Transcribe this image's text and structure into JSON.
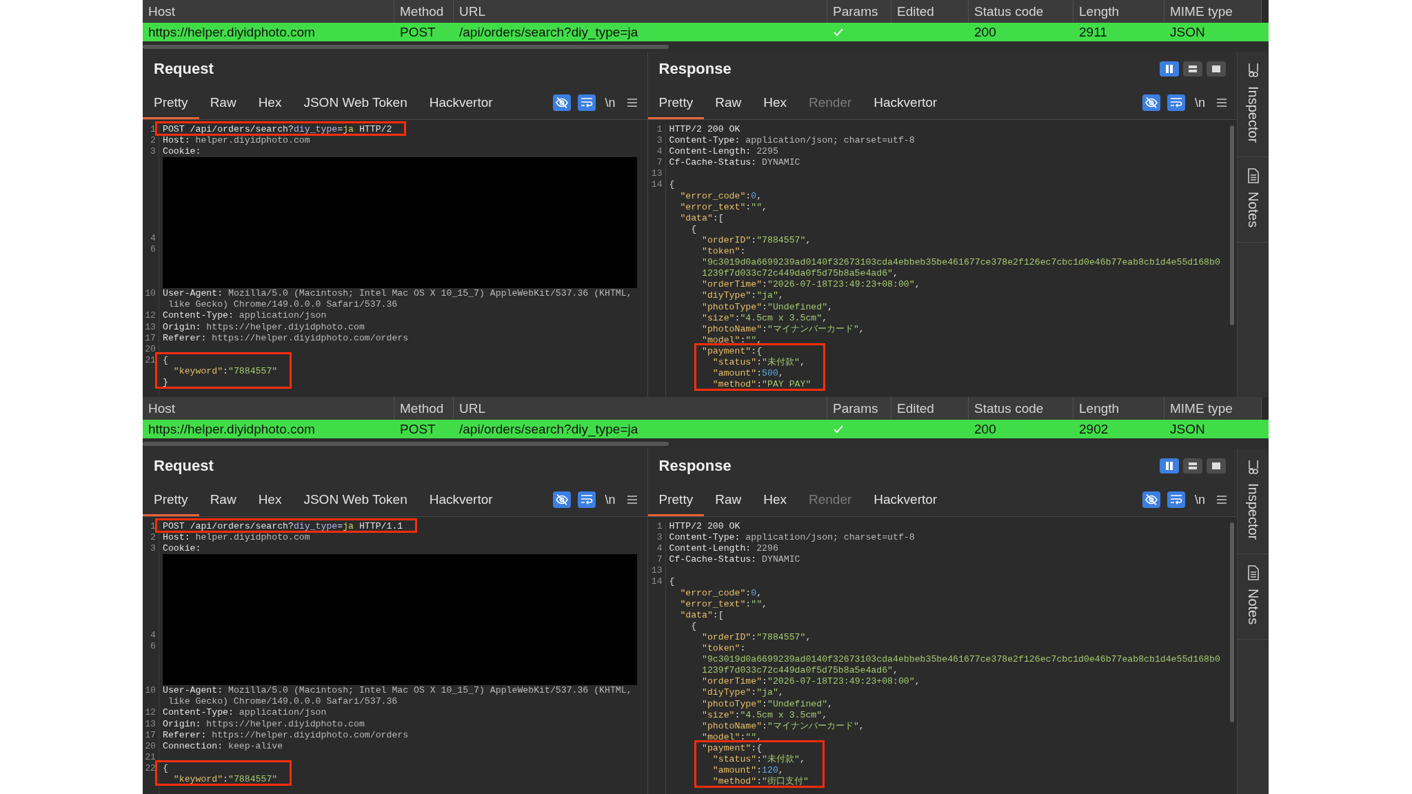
{
  "blocks": [
    {
      "table": {
        "columns": [
          "Host",
          "Method",
          "URL",
          "Params",
          "Edited",
          "Status code",
          "Length",
          "MIME type"
        ],
        "rows": [
          {
            "selected": true,
            "host": "https://helper.diyidphoto.com",
            "method": "POST",
            "url": "/api/orders/search?diy_type=ja",
            "params": true,
            "status_code": "200",
            "length": "2911",
            "mime_type": "JSON"
          }
        ]
      },
      "request": {
        "title": "Request",
        "tabs": [
          {
            "label": "Pretty",
            "selected": true,
            "disabled": false
          },
          {
            "label": "Raw",
            "selected": false,
            "disabled": false
          },
          {
            "label": "Hex",
            "selected": false,
            "disabled": false
          },
          {
            "label": "JSON Web Token",
            "selected": false,
            "disabled": false
          },
          {
            "label": "Hackvertor",
            "selected": false,
            "disabled": false
          }
        ],
        "toggles": [
          {
            "kind": "hide",
            "on": true
          },
          {
            "kind": "wrap",
            "on": true
          }
        ],
        "newline_label": "\\n",
        "lines": [
          {
            "n": "1",
            "kind": "start",
            "text": "POST /api/orders/search?diy_type=ja HTTP/2",
            "boxed": true
          },
          {
            "n": "2",
            "kind": "header",
            "text": "Host: helper.diyidphoto.com",
            "boxed": false
          },
          {
            "n": "3",
            "kind": "header",
            "text": "Cookie:",
            "boxed": false
          },
          {
            "kind": "redacted",
            "numbers": [
              "4",
              "6"
            ]
          },
          {
            "n": "10",
            "kind": "header",
            "text": "User-Agent: Mozilla/5.0 (Macintosh; Intel Mac OS X 10_15_7) AppleWebKit/537.36 (KHTML, like Gecko) Chrome/149.0.0.0 Safari/537.36",
            "boxed": false
          },
          {
            "n": "12",
            "kind": "header",
            "text": "Content-Type: application/json",
            "boxed": false
          },
          {
            "n": "13",
            "kind": "header",
            "text": "Origin: https://helper.diyidphoto.com",
            "boxed": false
          },
          {
            "n": "17",
            "kind": "header",
            "text": "Referer: https://helper.diyidphoto.com/orders",
            "boxed": false
          },
          {
            "n": "20",
            "kind": "blank",
            "boxed": false
          },
          {
            "n": "21",
            "kind": "json",
            "text": "{",
            "boxed": true
          },
          {
            "kind": "json",
            "text": "  \"keyword\":\"7884557\"",
            "boxed": true
          },
          {
            "kind": "json",
            "text": "}",
            "boxed": true
          }
        ]
      },
      "response": {
        "title": "Response",
        "layout_buttons": [
          {
            "kind": "split",
            "selected": true
          },
          {
            "kind": "rows",
            "selected": false
          },
          {
            "kind": "single",
            "selected": false
          }
        ],
        "tabs": [
          {
            "label": "Pretty",
            "selected": true,
            "disabled": false
          },
          {
            "label": "Raw",
            "selected": false,
            "disabled": false
          },
          {
            "label": "Hex",
            "selected": false,
            "disabled": false
          },
          {
            "label": "Render",
            "selected": false,
            "disabled": true
          },
          {
            "label": "Hackvertor",
            "selected": false,
            "disabled": false
          }
        ],
        "toggles": [
          {
            "kind": "hide",
            "on": true
          },
          {
            "kind": "wrap",
            "on": true
          }
        ],
        "newline_label": "\\n",
        "lines": [
          {
            "n": "1",
            "kind": "header",
            "text": "HTTP/2 200 OK",
            "boxed": false
          },
          {
            "n": "3",
            "kind": "header",
            "text": "Content-Type: application/json; charset=utf-8",
            "boxed": false
          },
          {
            "n": "4",
            "kind": "header",
            "text": "Content-Length: 2295",
            "boxed": false
          },
          {
            "n": "7",
            "kind": "header",
            "text": "Cf-Cache-Status: DYNAMIC",
            "boxed": false
          },
          {
            "n": "13",
            "kind": "blank",
            "boxed": false
          },
          {
            "n": "14",
            "kind": "json",
            "text": "{",
            "boxed": false
          },
          {
            "kind": "json",
            "text": "  \"error_code\":0,",
            "boxed": false
          },
          {
            "kind": "json",
            "text": "  \"error_text\":\"\",",
            "boxed": false
          },
          {
            "kind": "json",
            "text": "  \"data\":[",
            "boxed": false
          },
          {
            "kind": "json",
            "text": "    {",
            "boxed": false
          },
          {
            "kind": "json",
            "text": "      \"orderID\":\"7884557\",",
            "boxed": false
          },
          {
            "kind": "json",
            "text": "      \"token\":",
            "boxed": false
          },
          {
            "kind": "json",
            "text": "      \"9c3019d0a6699239ad0140f32673103cda4ebbeb35be461677ce378e2f126ec7cbc1d0e46b77eab8cb1d4e55d168b01239f7d033c72c449da0f5d75b8a5e4ad6\",",
            "boxed": false
          },
          {
            "kind": "json",
            "text": "      \"orderTime\":\"2026-07-18T23:49:23+08:00\",",
            "boxed": false
          },
          {
            "kind": "json",
            "text": "      \"diyType\":\"ja\",",
            "boxed": false
          },
          {
            "kind": "json",
            "text": "      \"photoType\":\"Undefined\",",
            "boxed": false
          },
          {
            "kind": "json",
            "text": "      \"size\":\"4.5cm x 3.5cm\",",
            "boxed": false
          },
          {
            "kind": "json",
            "text": "      \"photoName\":\"マイナンバーカード\",",
            "boxed": false
          },
          {
            "kind": "json",
            "text": "      \"model\":\"\",",
            "boxed": false
          },
          {
            "kind": "json",
            "text": "      \"payment\":{",
            "boxed": true
          },
          {
            "kind": "json",
            "text": "        \"status\":\"未付款\",",
            "boxed": true
          },
          {
            "kind": "json",
            "text": "        \"amount\":500,",
            "boxed": true
          },
          {
            "kind": "json",
            "text": "        \"method\":\"PAY PAY\"",
            "boxed": true
          }
        ]
      },
      "side_panel": {
        "items": [
          {
            "kind": "inspector",
            "label": "Inspector"
          },
          {
            "kind": "notes",
            "label": "Notes"
          }
        ]
      }
    },
    {
      "table": {
        "columns": [
          "Host",
          "Method",
          "URL",
          "Params",
          "Edited",
          "Status code",
          "Length",
          "MIME type"
        ],
        "rows": [
          {
            "selected": true,
            "host": "https://helper.diyidphoto.com",
            "method": "POST",
            "url": "/api/orders/search?diy_type=ja",
            "params": true,
            "status_code": "200",
            "length": "2902",
            "mime_type": "JSON"
          }
        ]
      },
      "request": {
        "title": "Request",
        "tabs": [
          {
            "label": "Pretty",
            "selected": true,
            "disabled": false
          },
          {
            "label": "Raw",
            "selected": false,
            "disabled": false
          },
          {
            "label": "Hex",
            "selected": false,
            "disabled": false
          },
          {
            "label": "JSON Web Token",
            "selected": false,
            "disabled": false
          },
          {
            "label": "Hackvertor",
            "selected": false,
            "disabled": false
          }
        ],
        "toggles": [
          {
            "kind": "hide",
            "on": true
          },
          {
            "kind": "wrap",
            "on": true
          }
        ],
        "newline_label": "\\n",
        "lines": [
          {
            "n": "1",
            "kind": "start",
            "text": "POST /api/orders/search?diy_type=ja HTTP/1.1",
            "boxed": true
          },
          {
            "n": "2",
            "kind": "header",
            "text": "Host: helper.diyidphoto.com",
            "boxed": false
          },
          {
            "n": "3",
            "kind": "header",
            "text": "Cookie:",
            "boxed": false
          },
          {
            "kind": "redacted",
            "numbers": [
              "4",
              "6"
            ]
          },
          {
            "n": "10",
            "kind": "header",
            "text": "User-Agent: Mozilla/5.0 (Macintosh; Intel Mac OS X 10_15_7) AppleWebKit/537.36 (KHTML, like Gecko) Chrome/149.0.0.0 Safari/537.36",
            "boxed": false
          },
          {
            "n": "12",
            "kind": "header",
            "text": "Content-Type: application/json",
            "boxed": false
          },
          {
            "n": "13",
            "kind": "header",
            "text": "Origin: https://helper.diyidphoto.com",
            "boxed": false
          },
          {
            "n": "17",
            "kind": "header",
            "text": "Referer: https://helper.diyidphoto.com/orders",
            "boxed": false
          },
          {
            "n": "20",
            "kind": "header",
            "text": "Connection: keep-alive",
            "boxed": false
          },
          {
            "n": "21",
            "kind": "blank",
            "boxed": false
          },
          {
            "n": "22",
            "kind": "json",
            "text": "{",
            "boxed": true
          },
          {
            "kind": "json",
            "text": "  \"keyword\":\"7884557\"",
            "boxed": true
          }
        ]
      },
      "response": {
        "title": "Response",
        "layout_buttons": [
          {
            "kind": "split",
            "selected": true
          },
          {
            "kind": "rows",
            "selected": false
          },
          {
            "kind": "single",
            "selected": false
          }
        ],
        "tabs": [
          {
            "label": "Pretty",
            "selected": true,
            "disabled": false
          },
          {
            "label": "Raw",
            "selected": false,
            "disabled": false
          },
          {
            "label": "Hex",
            "selected": false,
            "disabled": false
          },
          {
            "label": "Render",
            "selected": false,
            "disabled": true
          },
          {
            "label": "Hackvertor",
            "selected": false,
            "disabled": false
          }
        ],
        "toggles": [
          {
            "kind": "hide",
            "on": true
          },
          {
            "kind": "wrap",
            "on": true
          }
        ],
        "newline_label": "\\n",
        "lines": [
          {
            "n": "1",
            "kind": "header",
            "text": "HTTP/2 200 OK",
            "boxed": false
          },
          {
            "n": "3",
            "kind": "header",
            "text": "Content-Type: application/json; charset=utf-8",
            "boxed": false
          },
          {
            "n": "4",
            "kind": "header",
            "text": "Content-Length: 2296",
            "boxed": false
          },
          {
            "n": "7",
            "kind": "header",
            "text": "Cf-Cache-Status: DYNAMIC",
            "boxed": false
          },
          {
            "n": "13",
            "kind": "blank",
            "boxed": false
          },
          {
            "n": "14",
            "kind": "json",
            "text": "{",
            "boxed": false
          },
          {
            "kind": "json",
            "text": "  \"error_code\":0,",
            "boxed": false
          },
          {
            "kind": "json",
            "text": "  \"error_text\":\"\",",
            "boxed": false
          },
          {
            "kind": "json",
            "text": "  \"data\":[",
            "boxed": false
          },
          {
            "kind": "json",
            "text": "    {",
            "boxed": false
          },
          {
            "kind": "json",
            "text": "      \"orderID\":\"7884557\",",
            "boxed": false
          },
          {
            "kind": "json",
            "text": "      \"token\":",
            "boxed": false
          },
          {
            "kind": "json",
            "text": "      \"9c3019d0a6699239ad0140f32673103cda4ebbeb35be461677ce378e2f126ec7cbc1d0e46b77eab8cb1d4e55d168b01239f7d033c72c449da0f5d75b8a5e4ad6\",",
            "boxed": false
          },
          {
            "kind": "json",
            "text": "      \"orderTime\":\"2026-07-18T23:49:23+08:00\",",
            "boxed": false
          },
          {
            "kind": "json",
            "text": "      \"diyType\":\"ja\",",
            "boxed": false
          },
          {
            "kind": "json",
            "text": "      \"photoType\":\"Undefined\",",
            "boxed": false
          },
          {
            "kind": "json",
            "text": "      \"size\":\"4.5cm x 3.5cm\",",
            "boxed": false
          },
          {
            "kind": "json",
            "text": "      \"photoName\":\"マイナンバーカード\",",
            "boxed": false
          },
          {
            "kind": "json",
            "text": "      \"model\":\"\",",
            "boxed": false
          },
          {
            "kind": "json",
            "text": "      \"payment\":{",
            "boxed": true
          },
          {
            "kind": "json",
            "text": "        \"status\":\"未付款\",",
            "boxed": true
          },
          {
            "kind": "json",
            "text": "        \"amount\":120,",
            "boxed": true
          },
          {
            "kind": "json",
            "text": "        \"method\":\"街口支付\"",
            "boxed": true
          }
        ]
      },
      "side_panel": {
        "items": [
          {
            "kind": "inspector",
            "label": "Inspector"
          },
          {
            "kind": "notes",
            "label": "Notes"
          }
        ]
      }
    }
  ]
}
